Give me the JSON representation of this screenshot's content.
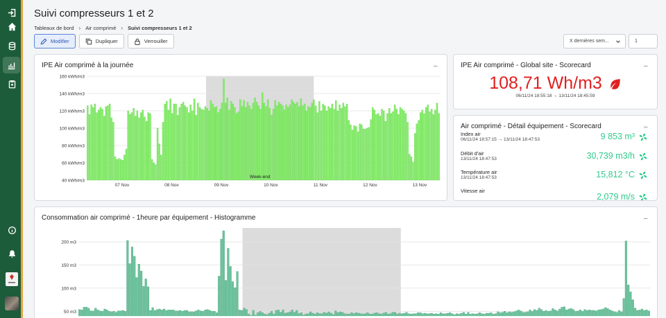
{
  "page": {
    "title": "Suivi compresseurs 1 et 2",
    "breadcrumb": [
      "Tableaux de bord",
      "Air comprimé",
      "Suivi compresseurs 1 et 2"
    ]
  },
  "toolbar": {
    "edit_label": "Modifier",
    "duplicate_label": "Dupliquer",
    "lock_label": "Verrouiller",
    "time_select_value": "X dernières sem...",
    "count_value": "1"
  },
  "colors": {
    "sidebar": "#1d5c3a",
    "sidebar_accent": "#e8a33a",
    "primary_button": "#5a86d6",
    "scorecard_value_red": "#e02020",
    "scorecard_value_green": "#2ecc8c",
    "bar_green": "#86ee6a",
    "bar_teal": "#6cc29c"
  },
  "sidebar": {
    "icons": [
      "login-icon",
      "home-icon",
      "database-icon",
      "chart-icon",
      "clipboard-icon",
      "info-icon",
      "bell-icon",
      "logo",
      "avatar"
    ]
  },
  "panels": {
    "ipe_day": {
      "title": "IPE Air comprimé à la journée",
      "menu": "..."
    },
    "global_scorecard": {
      "title": "IPE Air comprimé - Global site - Scorecard",
      "menu": "...",
      "value": "108,71 Wh/m3",
      "range": "06/11/24 18:55:18 → 13/11/24 18:45:59"
    },
    "equipment_scorecard": {
      "title": "Air comprimé - Détail équipement - Scorecard",
      "menu": "...",
      "rows": [
        {
          "name": "Index air",
          "time": "06/11/24 18:57:15 → 13/11/24 18:47:53",
          "value": "9 853 m³"
        },
        {
          "name": "Débit d'air",
          "time": "13/11/24 18:47:53",
          "value": "30,739 m3/h"
        },
        {
          "name": "Température air",
          "time": "13/11/24 18:47:53",
          "value": "15,812 °C"
        },
        {
          "name": "Vitesse air",
          "time": "",
          "value": "2,079 m/s"
        }
      ]
    },
    "hourly": {
      "title": "Consommation air comprimé - 1heure par équipement - Histogramme",
      "menu": "..."
    }
  },
  "chart_data": [
    {
      "type": "bar",
      "ylim": [
        40,
        160
      ],
      "yticks": [
        "40 kWh/m3",
        "60 kWh/m3",
        "80 kWh/m3",
        "100 kWh/m3",
        "120 kWh/m3",
        "140 kWh/m3",
        "160 kWh/m3"
      ],
      "xticks": [
        "07 Nov",
        "08 Nov",
        "09 Nov",
        "10 Nov",
        "11 Nov",
        "12 Nov",
        "13 Nov"
      ],
      "annotation": "Week-end",
      "shaded_range": [
        0.338,
        0.643
      ],
      "grid": true,
      "values": [
        126,
        116,
        127,
        124,
        128,
        118,
        121,
        124,
        122,
        114,
        125,
        126,
        128,
        112,
        107,
        67,
        64,
        65,
        64,
        63,
        69,
        76,
        120,
        116,
        118,
        123,
        114,
        120,
        112,
        118,
        121,
        113,
        108,
        118,
        117,
        64,
        60,
        58,
        100,
        82,
        69,
        107,
        128,
        131,
        121,
        134,
        117,
        128,
        128,
        115,
        124,
        128,
        130,
        126,
        124,
        118,
        127,
        120,
        134,
        115,
        129,
        124,
        122,
        121,
        125,
        123,
        120,
        132,
        128,
        124,
        125,
        118,
        122,
        129,
        157,
        129,
        135,
        121,
        131,
        128,
        124,
        117,
        119,
        133,
        125,
        132,
        124,
        130,
        126,
        122,
        129,
        135,
        130,
        126,
        122,
        141,
        129,
        125,
        133,
        123,
        115,
        122,
        132,
        126,
        130,
        128,
        126,
        121,
        127,
        124,
        127,
        133,
        130,
        128,
        130,
        125,
        134,
        126,
        128,
        120,
        125,
        124,
        129,
        133,
        126,
        118,
        131,
        120,
        128,
        126,
        120,
        125,
        123,
        128,
        122,
        132,
        120,
        127,
        123,
        129,
        125,
        128,
        109,
        104,
        98,
        103,
        102,
        96,
        105,
        104,
        99,
        99,
        100,
        101,
        110,
        124,
        121,
        116,
        117,
        114,
        122,
        120,
        108,
        117,
        123,
        117,
        119,
        127,
        122,
        116,
        124,
        122,
        120,
        117,
        107,
        70,
        67,
        61,
        94,
        105,
        109,
        118,
        121,
        117,
        124,
        127,
        119,
        122,
        116,
        121,
        129,
        117
      ]
    },
    {
      "type": "bar",
      "ylim": [
        40,
        230
      ],
      "yticks": [
        "50 m3",
        "100 m3",
        "150 m3",
        "200 m3"
      ],
      "grid": true,
      "shaded_range": [
        0.287,
        0.564
      ],
      "values": [
        54,
        53,
        59,
        59,
        57,
        51,
        51,
        57,
        53,
        51,
        50,
        55,
        53,
        50,
        49,
        50,
        48,
        51,
        51,
        52,
        50,
        203,
        153,
        189,
        169,
        123,
        152,
        137,
        104,
        120,
        103,
        52,
        58,
        52,
        54,
        55,
        53,
        55,
        52,
        53,
        53,
        53,
        51,
        51,
        52,
        50,
        52,
        52,
        49,
        49,
        49,
        51,
        53,
        51,
        50,
        53,
        54,
        52,
        50,
        50,
        47,
        126,
        206,
        224,
        117,
        186,
        147,
        114,
        101,
        136,
        53,
        52,
        57,
        54,
        44,
        41,
        52,
        42,
        47,
        50,
        47,
        44,
        43,
        46,
        50,
        44,
        52,
        53,
        48,
        53,
        46,
        47,
        49,
        53,
        48,
        52,
        45,
        47,
        42,
        44,
        45,
        49,
        46,
        44,
        47,
        45,
        45,
        48,
        46,
        49,
        46,
        43,
        51,
        47,
        49,
        48,
        45,
        44,
        44,
        47,
        45,
        47,
        46,
        45,
        44,
        45,
        47,
        44,
        44,
        46,
        47,
        45,
        44,
        46,
        48,
        44,
        45,
        48,
        48,
        44,
        46,
        45,
        46,
        48,
        45,
        44,
        45,
        45,
        47,
        47,
        45,
        46,
        45,
        45,
        46,
        44,
        45,
        44,
        47,
        45,
        45,
        46,
        47,
        45,
        43,
        45,
        44,
        46,
        48,
        44,
        48,
        44,
        45,
        44,
        45,
        47,
        45,
        44,
        46,
        46,
        47,
        44,
        45,
        49,
        47,
        48,
        50,
        47,
        49,
        48,
        49,
        51,
        53,
        51,
        48,
        48,
        49,
        53,
        50,
        54,
        52,
        57,
        54,
        50,
        52,
        50,
        51,
        56,
        53,
        51,
        55,
        59,
        60,
        53,
        55,
        56,
        54,
        50,
        51,
        53,
        50,
        54,
        52,
        53,
        52,
        52,
        51,
        53,
        54,
        55,
        58,
        56,
        53,
        51,
        49,
        48,
        52,
        49,
        78,
        202,
        107,
        92,
        75,
        57,
        52,
        53,
        55,
        52,
        53,
        51
      ]
    }
  ]
}
